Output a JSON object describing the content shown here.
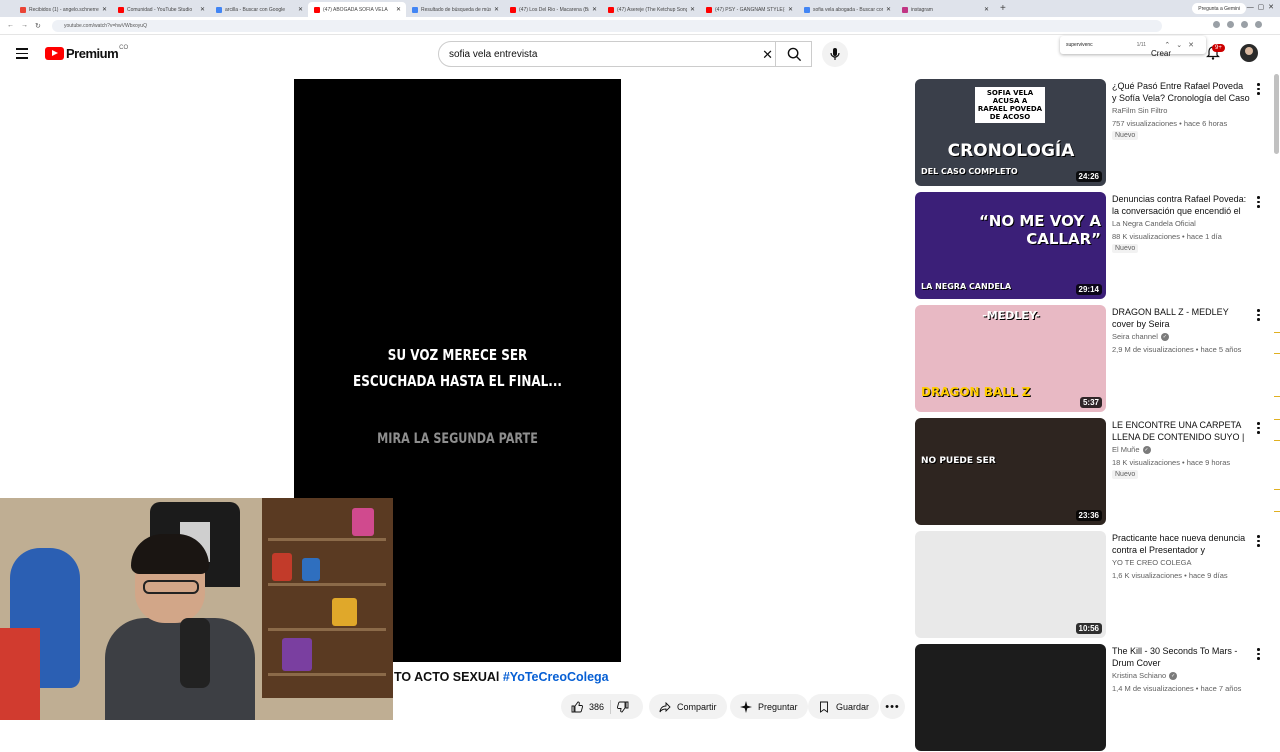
{
  "browser": {
    "tabs": [
      {
        "title": "Recibidos (1) - angelo.schnerre",
        "color": "#ea4335",
        "active": false
      },
      {
        "title": "Comunidad - YouTube Studio",
        "color": "#ff0000",
        "active": false
      },
      {
        "title": "arcilla - Buscar con Google",
        "color": "#4285f4",
        "active": false
      },
      {
        "title": "(47) ABOGADA SOFIA VELA",
        "color": "#ff0000",
        "active": true
      },
      {
        "title": "Resultado de búsqueda de música",
        "color": "#4285f4",
        "active": false
      },
      {
        "title": "(47) Los Del Rio - Macarena (Ba",
        "color": "#ff0000",
        "active": false
      },
      {
        "title": "(47) Asereje (The Ketchup Song)",
        "color": "#ff0000",
        "active": false
      },
      {
        "title": "(47) PSY - GANGNAM STYLE(강",
        "color": "#ff0000",
        "active": false
      },
      {
        "title": "sofia vela abogada - Buscar con",
        "color": "#4285f4",
        "active": false
      },
      {
        "title": "instagram",
        "color": "#c13584",
        "active": false
      }
    ],
    "new_tab": "+",
    "gemini_label": "Pregunta a Gemini",
    "url": "youtube.com/watch?v=hwVWbxoyuQ"
  },
  "header": {
    "logo_word": "Premium",
    "country": "CO",
    "search_value": "sofia vela entrevista",
    "create_label": "Crear",
    "notif_badge": "9+"
  },
  "findbar": {
    "query": "supervivenc",
    "count": "1/11"
  },
  "player": {
    "overlay_line1": "SU VOZ MERECE SER",
    "overlay_line2": "ESCUCHADA HASTA EL FINAL...",
    "overlay_sub": "MIRA LA SEGUNDA PARTE"
  },
  "video": {
    "title_text": "TO ACTO SEXUAl ",
    "hashtag": "#YoTeCreoColega",
    "likes": "386",
    "share_label": "Compartir",
    "ask_label": "Preguntar",
    "save_label": "Guardar"
  },
  "recommendations": [
    {
      "title": "¿Qué Pasó Entre Rafael Poveda y Sofía Vela? Cronología del Caso ...",
      "channel": "RaFilm Sin Filtro",
      "verified": false,
      "meta": "757 visualizaciones • hace 6 horas",
      "badge": "Nuevo",
      "duration": "24:26",
      "thumb_text": "CRONOLOGÍA",
      "thumb_sub": "DEL CASO COMPLETO",
      "thumb_top": "SOFIA VELA ACUSA A RAFAEL POVEDA DE ACOSO",
      "bg": "#3a3f4a"
    },
    {
      "title": "Denuncias contra Rafael Poveda: la conversación que encendió el ...",
      "channel": "La Negra Candela Oficial",
      "verified": false,
      "meta": "88 K visualizaciones • hace 1 día",
      "badge": "Nuevo",
      "duration": "29:14",
      "thumb_text": "“NO ME VOY A CALLAR”",
      "thumb_sub": "LA NEGRA CANDELA",
      "thumb_top": "",
      "bg": "#3b1f78"
    },
    {
      "title": "DRAGON BALL Z - MEDLEY cover by Seira",
      "channel": "Seira channel",
      "verified": true,
      "meta": "2,9 M de visualizaciones • hace 5 años",
      "badge": "",
      "duration": "5:37",
      "thumb_text": "-MEDLEY-",
      "thumb_sub": "DRAGON BALL Z",
      "thumb_top": "",
      "bg": "#e8b9c4"
    },
    {
      "title": "LE ENCONTRE UNA CARPETA LLENA DE CONTENIDO SUYO | ...",
      "channel": "El Muñe",
      "verified": true,
      "meta": "18 K visualizaciones • hace 9 horas",
      "badge": "Nuevo",
      "duration": "23:36",
      "thumb_text": "NO PUEDE SER",
      "thumb_sub": "",
      "thumb_top": "",
      "bg": "#2e2520"
    },
    {
      "title": "Practicante hace nueva denuncia contra el Presentador y Periodist...",
      "channel": "YO TE CREO COLEGA",
      "verified": false,
      "meta": "1,6 K visualizaciones • hace 9 días",
      "badge": "",
      "duration": "10:56",
      "thumb_text": "",
      "thumb_sub": "",
      "thumb_top": "",
      "bg": "#e9e9e9"
    },
    {
      "title": "The Kill - 30 Seconds To Mars - Drum Cover",
      "channel": "Kristina Schiano",
      "verified": true,
      "meta": "1,4 M de visualizaciones • hace 7 años",
      "badge": "",
      "duration": "",
      "thumb_text": "",
      "thumb_sub": "",
      "thumb_top": "",
      "bg": "#1c1c1c"
    }
  ]
}
